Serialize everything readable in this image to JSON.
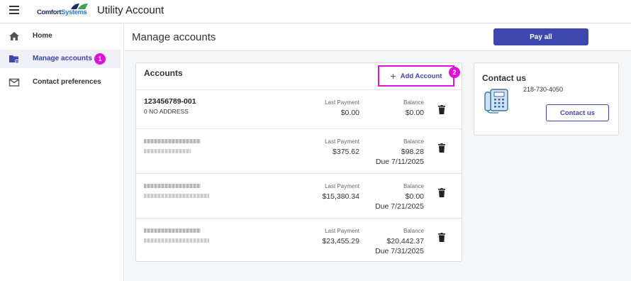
{
  "app": {
    "brand": "ComfortSystems",
    "title": "Utility Account"
  },
  "sidebar": {
    "items": [
      {
        "label": "Home",
        "icon": "home-icon"
      },
      {
        "label": "Manage accounts",
        "icon": "folder-settings-icon",
        "badge": "1"
      },
      {
        "label": "Contact preferences",
        "icon": "mail-icon"
      }
    ]
  },
  "main": {
    "title": "Manage accounts",
    "pay_all_label": "Pay all"
  },
  "accounts": {
    "title": "Accounts",
    "add_label": "Add Account",
    "add_badge": "2",
    "last_payment_label": "Last Payment",
    "balance_label": "Balance",
    "rows": [
      {
        "number": "123456789-001",
        "address": "0 NO ADDRESS",
        "last_payment": "$0.00",
        "balance": "$0.00",
        "due": ""
      },
      {
        "number": "",
        "address": "",
        "last_payment": "$375.62",
        "balance": "$98.28",
        "due": "Due 7/11/2025"
      },
      {
        "number": "",
        "address": "",
        "last_payment": "$15,380.34",
        "balance": "$0.00",
        "due": "Due 7/21/2025"
      },
      {
        "number": "",
        "address": "",
        "last_payment": "$23,455.29",
        "balance": "$20,442.37",
        "due": "Due 7/31/2025"
      }
    ]
  },
  "contact": {
    "title": "Contact us",
    "phone": "218-730-4050",
    "button_label": "Contact us"
  },
  "colors": {
    "primary": "#3d47ae",
    "highlight": "#e010d6"
  }
}
